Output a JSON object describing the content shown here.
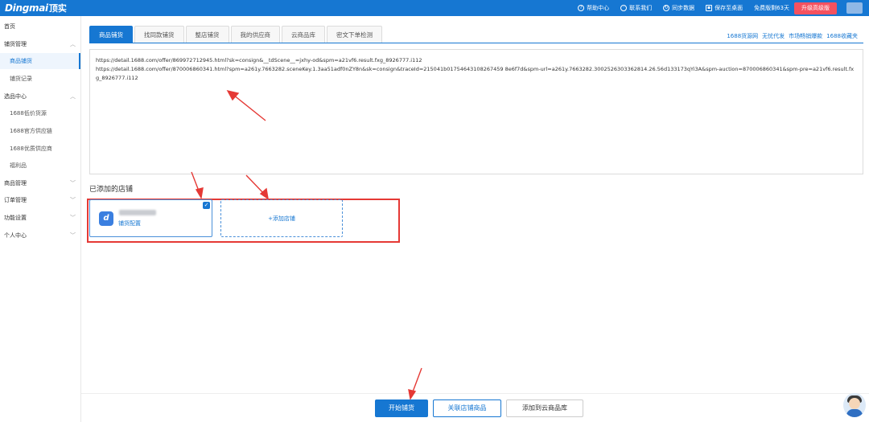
{
  "header": {
    "logo_text": "Dingmai",
    "logo_cn": "顶实",
    "menu": [
      {
        "label": "帮助中心",
        "icon": "help-icon"
      },
      {
        "label": "联系我们",
        "icon": "chat-icon"
      },
      {
        "label": "同步数据",
        "icon": "sync-icon"
      },
      {
        "label": "保存至桌面",
        "icon": "save-icon"
      }
    ],
    "trial_text": "免费版剩63天",
    "upgrade_label": "升级高级版"
  },
  "sidebar": {
    "home": "首页",
    "groups": [
      {
        "label": "铺货管理",
        "expanded": true
      },
      {
        "label": "选品中心",
        "expanded": true
      },
      {
        "label": "商品管理",
        "expanded": false
      },
      {
        "label": "订单管理",
        "expanded": false
      },
      {
        "label": "功能设置",
        "expanded": false
      },
      {
        "label": "个人中心",
        "expanded": false
      }
    ],
    "distribution_items": [
      "商品铺货",
      "铺货记录"
    ],
    "selection_items": [
      "1688低价货源",
      "1688官方供应链",
      "1688优质供应商",
      "福利品"
    ],
    "active_item": "商品铺货"
  },
  "tabs": [
    {
      "label": "商品铺货",
      "active": true
    },
    {
      "label": "找同款铺货",
      "active": false
    },
    {
      "label": "整店铺货",
      "active": false
    },
    {
      "label": "我的供应商",
      "active": false
    },
    {
      "label": "云商品库",
      "active": false
    },
    {
      "label": "密文下单检测",
      "active": false
    }
  ],
  "quick_links": [
    "1688货源网",
    "无忧代发",
    "市场畅销爆款",
    "1688收藏夹"
  ],
  "url_input": {
    "lines": [
      "https://detail.1688.com/offer/869972712945.html?sk=consign&__tdScene__=jxhy-od&spm=a21vf6.result.fxg_8926777.i112",
      "https://detail.1688.com/offer/870006860341.html?spm=a261y.7663282.sceneKey.1.3aa51adf0nZY8n&sk=consign&traceId=215041b01754643108267459 8e6f7d&spm-url=a261y.7663282.3002526303362814.26.56d133173qYi3A&spm-auction=870006860341&spm-pre=a21vf6.result.fxg_8926777.i112"
    ]
  },
  "stores": {
    "section_title": "已添加的店铺",
    "store_config_label": "铺货配置",
    "add_store_label": "+添加店铺"
  },
  "actions": {
    "start_label": "开始铺货",
    "link_label": "关联店铺商品",
    "cloud_label": "添加到云商品库"
  },
  "colors": {
    "primary": "#1677d2",
    "upgrade": "#f5515f",
    "highlight": "#e53935"
  }
}
